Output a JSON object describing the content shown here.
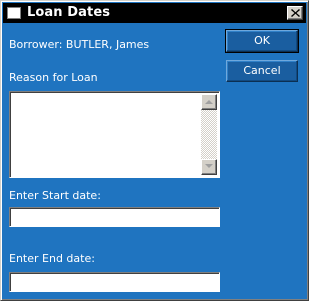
{
  "window": {
    "title": "Loan Dates",
    "close_symbol": "×"
  },
  "borrower": {
    "text": "Borrower: BUTLER, James"
  },
  "reason": {
    "label": "Reason for Loan",
    "value": ""
  },
  "start_date": {
    "label": "Enter Start date:",
    "value": ""
  },
  "end_date": {
    "label": "Enter End date:",
    "value": ""
  },
  "buttons": {
    "ok_label": "OK",
    "cancel_label": "Cancel"
  },
  "icons": {
    "window_icon": "window-icon",
    "close": "close-icon",
    "scroll_up": "arrow-up-icon",
    "scroll_down": "arrow-down-icon"
  },
  "colors": {
    "dialog_background": "#1f74c0",
    "titlebar_background": "#000000",
    "button_background": "#1a5ea0",
    "text": "#ffffff"
  }
}
